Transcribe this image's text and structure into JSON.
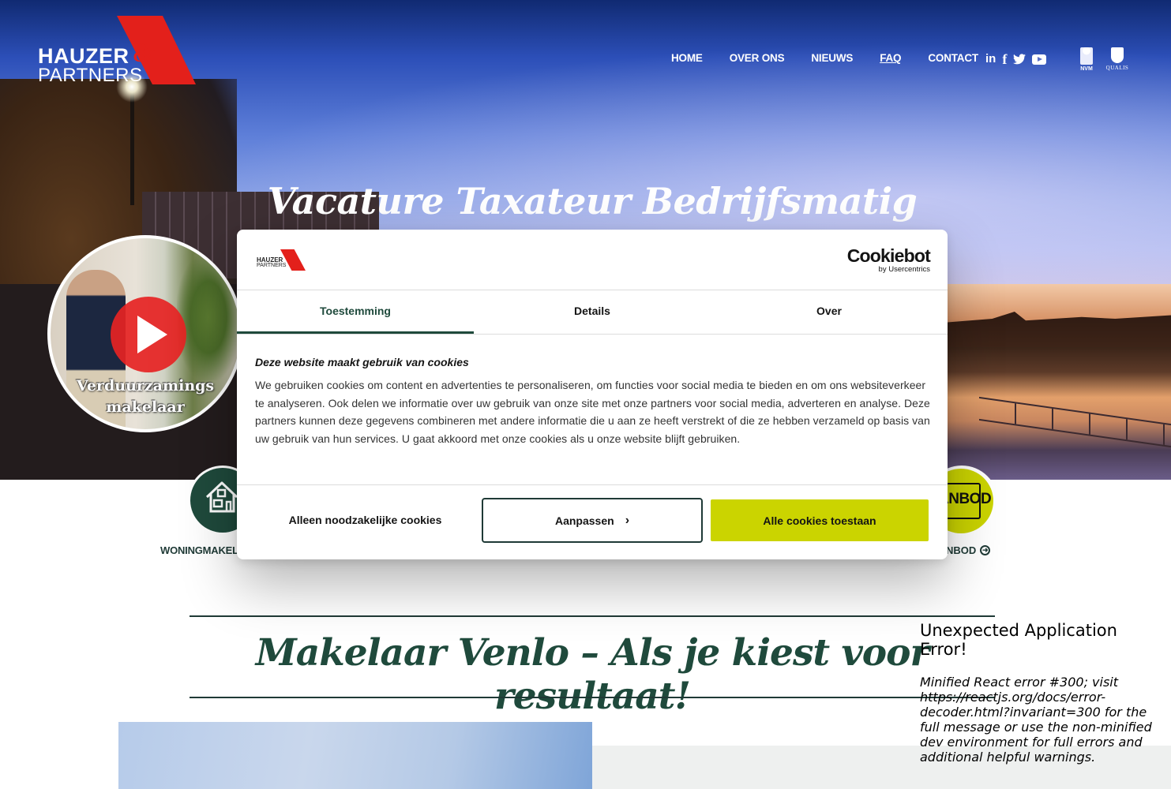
{
  "header": {
    "logo": {
      "line1": "HAUZER",
      "line2": "PARTNERS",
      "ampersand": "&"
    },
    "nav": [
      {
        "label": "HOME"
      },
      {
        "label": "OVER ONS"
      },
      {
        "label": "NIEUWS"
      },
      {
        "label": "FAQ"
      },
      {
        "label": "CONTACT"
      }
    ],
    "social": [
      {
        "icon": "linkedin-icon",
        "glyph": "in"
      },
      {
        "icon": "facebook-icon",
        "glyph": "f"
      },
      {
        "icon": "twitter-icon",
        "glyph": "🐦"
      },
      {
        "icon": "youtube-icon",
        "glyph": ""
      }
    ],
    "certifications": [
      {
        "icon": "nvm-logo",
        "caption": "NVM"
      },
      {
        "icon": "qualis-logo",
        "caption": "QUALIS"
      }
    ]
  },
  "hero": {
    "title": "Vacature Taxateur Bedrijfsmatig",
    "video": {
      "caption_line1": "Verduurzamings",
      "caption_line2": "makelaar"
    }
  },
  "services": [
    {
      "label": "WONINGMAKELAAR",
      "visible_label": "WONINGMAKEL"
    },
    {
      "label": "BOD",
      "visible_label": "NBOD",
      "badge_text": "ANBOD"
    }
  ],
  "section": {
    "title": "Makelaar Venlo – Als je kiest voor resultaat!"
  },
  "cookie_dialog": {
    "logo": {
      "line1": "HAUZER",
      "line2": "PARTNERS"
    },
    "brand": {
      "name": "Cookiebot",
      "by": "by Usercentrics"
    },
    "tabs": [
      {
        "label": "Toestemming",
        "active": true
      },
      {
        "label": "Details",
        "active": false
      },
      {
        "label": "Over",
        "active": false
      }
    ],
    "heading": "Deze website maakt gebruik van cookies",
    "body": "We gebruiken cookies om content en advertenties te personaliseren, om functies voor social media te bieden en om ons websiteverkeer te analyseren. Ook delen we informatie over uw gebruik van onze site met onze partners voor social media, adverteren en analyse. Deze partners kunnen deze gegevens combineren met andere informatie die u aan ze heeft verstrekt of die ze hebben verzameld op basis van uw gebruik van hun services. U gaat akkoord met onze cookies als u onze website blijft gebruiken.",
    "buttons": {
      "necessary": "Alleen noodzakelijke cookies",
      "customize": "Aanpassen",
      "allow_all": "Alle cookies toestaan"
    },
    "colors": {
      "accent": "#1f4a3c",
      "allow_button": "#cbd400"
    }
  },
  "error_overlay": {
    "title": "Unexpected Application Error!",
    "message": "Minified React error #300; visit https://reactjs.org/docs/error-decoder.html?invariant=300 for the full message or use the non-minified dev environment for full errors and additional helpful warnings."
  },
  "colors": {
    "brand_red": "#e3201b",
    "brand_green": "#1f4a3c",
    "lime": "#cbd400"
  }
}
